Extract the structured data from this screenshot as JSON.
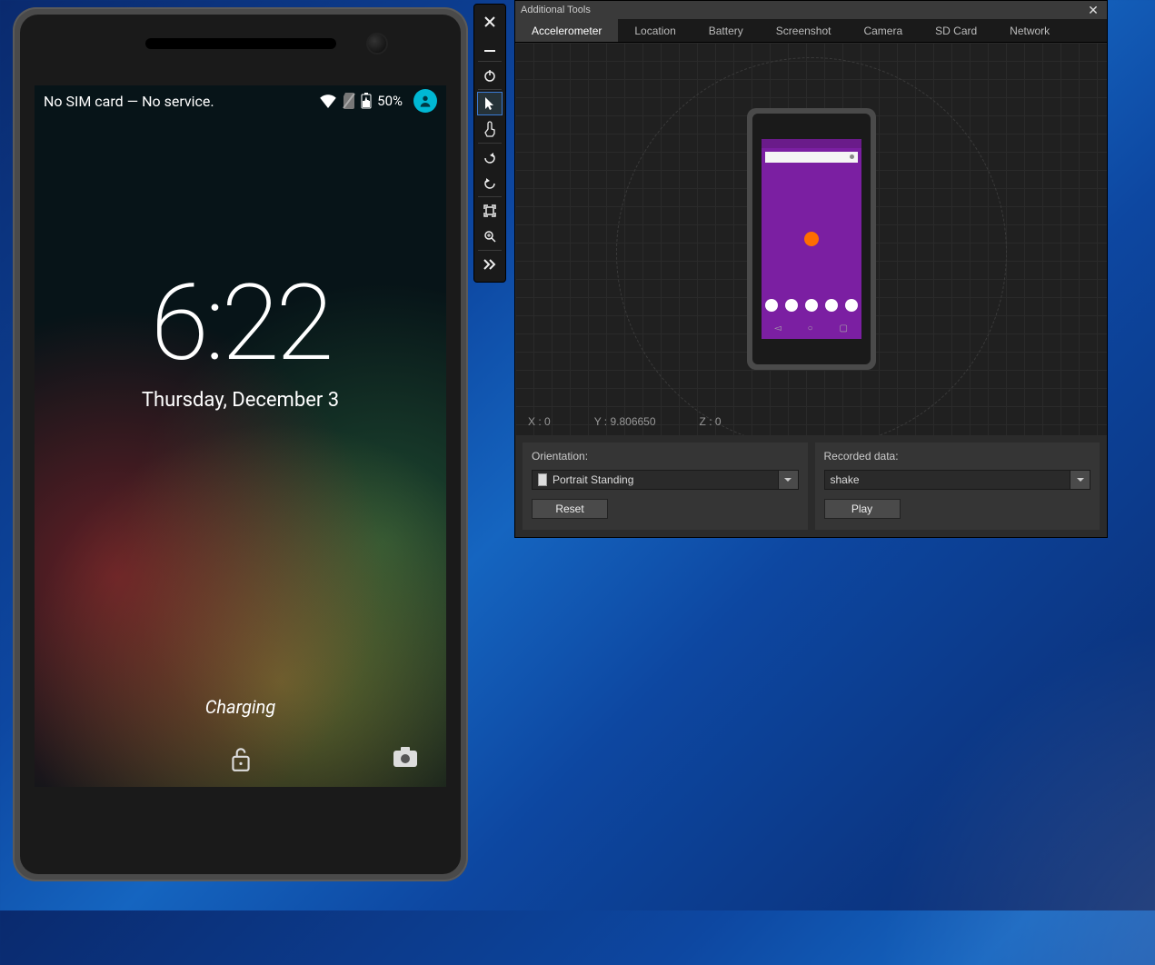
{
  "device": {
    "status_text": "No SIM card — No service.",
    "battery_text": "50%",
    "clock_time": "6:22",
    "clock_date": "Thursday, December 3",
    "charging_text": "Charging"
  },
  "toolbar": {
    "buttons": [
      {
        "name": "close-icon"
      },
      {
        "name": "minimize-icon"
      },
      {
        "name": "power-icon"
      },
      {
        "name": "cursor-icon",
        "selected": true
      },
      {
        "name": "touch-icon"
      },
      {
        "name": "rotate-left-icon"
      },
      {
        "name": "rotate-right-icon"
      },
      {
        "name": "fit-screen-icon"
      },
      {
        "name": "zoom-icon"
      },
      {
        "name": "chevrons-right-icon"
      }
    ]
  },
  "panel": {
    "title": "Additional Tools",
    "tabs": [
      "Accelerometer",
      "Location",
      "Battery",
      "Screenshot",
      "Camera",
      "SD Card",
      "Network"
    ],
    "active_tab": 0,
    "coords": {
      "x_label": "X : 0",
      "y_label": "Y : 9.806650",
      "z_label": "Z : 0"
    },
    "orientation": {
      "label": "Orientation:",
      "value": "Portrait Standing",
      "reset_label": "Reset"
    },
    "recorded": {
      "label": "Recorded data:",
      "value": "shake",
      "play_label": "Play"
    }
  }
}
